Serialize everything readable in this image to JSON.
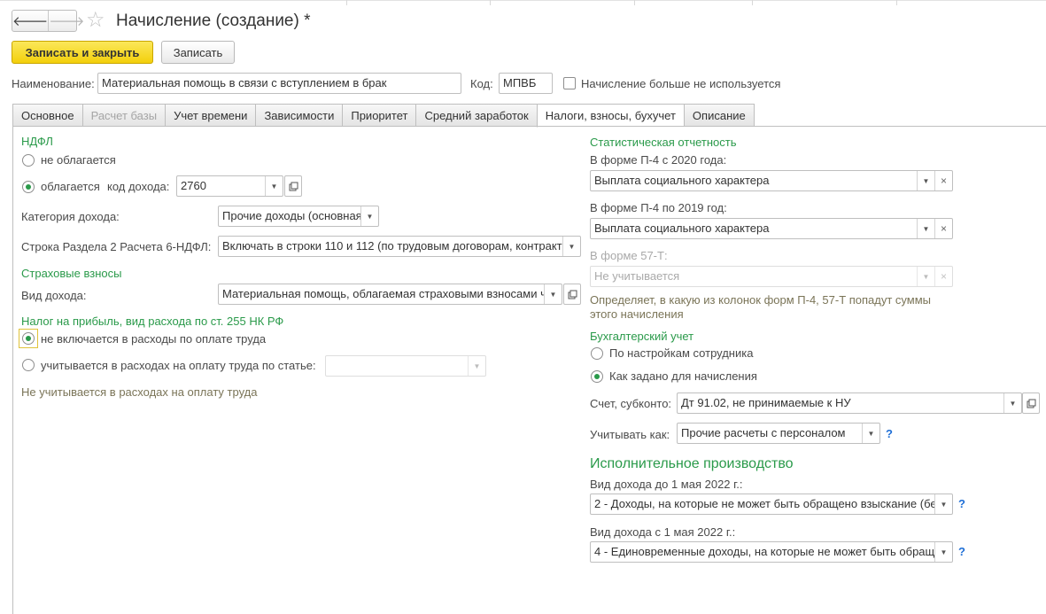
{
  "window": {
    "title": "Начисление (создание) *"
  },
  "nav": {
    "back": "🡐",
    "forward": "🡒"
  },
  "toolbar": {
    "save_close": "Записать и закрыть",
    "save": "Записать"
  },
  "header": {
    "name_label": "Наименование:",
    "name_value": "Материальная помощь в связи с вступлением в брак",
    "code_label": "Код:",
    "code_value": "МПВБ",
    "unused_label": "Начисление больше не используется"
  },
  "tabs": [
    {
      "label": "Основное"
    },
    {
      "label": "Расчет базы"
    },
    {
      "label": "Учет времени"
    },
    {
      "label": "Зависимости"
    },
    {
      "label": "Приоритет"
    },
    {
      "label": "Средний заработок"
    },
    {
      "label": "Налоги, взносы, бухучет"
    },
    {
      "label": "Описание"
    }
  ],
  "ndfl": {
    "heading": "НДФЛ",
    "not_taxed": "не облагается",
    "taxed": "облагается",
    "code_label": "код дохода:",
    "code_value": "2760",
    "category_label": "Категория дохода:",
    "category_value": "Прочие доходы (основная",
    "row_label": "Строка Раздела 2 Расчета 6-НДФЛ:",
    "row_value": "Включать в строки 110 и 112 (по трудовым договорам, контракт"
  },
  "insurance": {
    "heading": "Страховые взносы",
    "kind_label": "Вид дохода:",
    "kind_value": "Материальная помощь, облагаемая страховыми взносами ч"
  },
  "profit_tax": {
    "heading": "Налог на прибыль, вид расхода по ст. 255 НК РФ",
    "not_included": "не включается в расходы по оплате труда",
    "included": "учитывается в расходах на оплату труда по статье:",
    "note": "Не учитывается в расходах на оплату труда"
  },
  "stats": {
    "heading": "Статистическая отчетность",
    "p4_2020_label": "В форме П-4 с 2020 года:",
    "p4_2020_value": "Выплата социального характера",
    "p4_2019_label": "В форме П-4 по 2019 год:",
    "p4_2019_value": "Выплата социального характера",
    "f57_label": "В форме 57-Т:",
    "f57_value": "Не учитывается",
    "note_line1": "Определяет, в какую из колонок форм П-4, 57-Т попадут суммы",
    "note_line2": "этого начисления"
  },
  "accounting": {
    "heading": "Бухгалтерский учет",
    "by_employee": "По настройкам сотрудника",
    "as_accrual": "Как задано для начисления",
    "account_label": "Счет, субконто:",
    "account_value": "Дт 91.02, не принимаемые к НУ",
    "consider_label": "Учитывать как:",
    "consider_value": "Прочие расчеты с персоналом",
    "help": "?"
  },
  "enforcement": {
    "heading": "Исполнительное производство",
    "before_label": "Вид дохода до 1 мая 2022 г.:",
    "before_value": "2 - Доходы, на которые не может быть обращено взыскание (бе",
    "after_label": "Вид дохода с 1 мая 2022 г.:",
    "after_value": "4 - Единовременные доходы, на которые не может быть обращ",
    "help": "?"
  },
  "icons": {
    "star": "☆",
    "dropdown": "▼",
    "clear": "×"
  }
}
